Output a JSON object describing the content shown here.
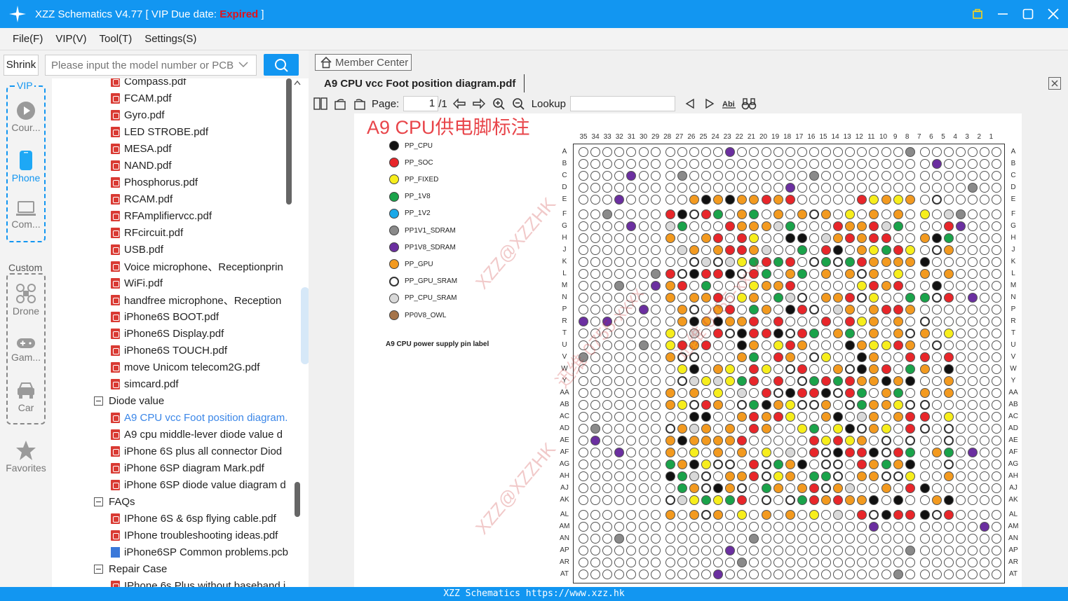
{
  "window": {
    "title_prefix": "XZZ Schematics V4.77 [ VIP Due date: ",
    "title_status": "Expired",
    "title_suffix": " ]"
  },
  "menu": [
    "File(F)",
    "VIP(V)",
    "Tool(T)",
    "Settings(S)"
  ],
  "search": {
    "shrink_label": "Shrink",
    "placeholder": "Please input the model number or PCB"
  },
  "rail": {
    "vip_label": "VIP",
    "custom_label": "Custom",
    "items": [
      "Cour...",
      "Phone",
      "Com...",
      "Drone",
      "Gam...",
      "Car",
      "Favorites"
    ]
  },
  "tree": {
    "items": [
      {
        "type": "pdf",
        "label": "Compass.pdf"
      },
      {
        "type": "pdf",
        "label": "FCAM.pdf"
      },
      {
        "type": "pdf",
        "label": "Gyro.pdf"
      },
      {
        "type": "pdf",
        "label": "LED STROBE.pdf"
      },
      {
        "type": "pdf",
        "label": "MESA.pdf"
      },
      {
        "type": "pdf",
        "label": "NAND.pdf"
      },
      {
        "type": "pdf",
        "label": "Phosphorus.pdf"
      },
      {
        "type": "pdf",
        "label": "RCAM.pdf"
      },
      {
        "type": "pdf",
        "label": "RFAmplifiervcc.pdf"
      },
      {
        "type": "pdf",
        "label": "RFcircuit.pdf"
      },
      {
        "type": "pdf",
        "label": "USB.pdf"
      },
      {
        "type": "pdf",
        "label": "Voice microphone、Receptionprin"
      },
      {
        "type": "pdf",
        "label": "WiFi.pdf"
      },
      {
        "type": "pdf",
        "label": "handfree microphone、Reception"
      },
      {
        "type": "pdf",
        "label": "iPhone6S BOOT.pdf"
      },
      {
        "type": "pdf",
        "label": "iPhone6S Display.pdf"
      },
      {
        "type": "pdf",
        "label": "iPhone6S TOUCH.pdf"
      },
      {
        "type": "pdf",
        "label": "move Unicom telecom2G.pdf"
      },
      {
        "type": "pdf",
        "label": "simcard.pdf"
      },
      {
        "type": "folder",
        "label": "Diode value"
      },
      {
        "type": "pdf",
        "label": "A9 CPU vcc Foot position diagram.",
        "selected": true
      },
      {
        "type": "pdf",
        "label": "A9 cpu middle-lever diode value d"
      },
      {
        "type": "pdf",
        "label": "iPhone 6S plus all connector Diod"
      },
      {
        "type": "pdf",
        "label": "iPhone 6SP diagram Mark.pdf"
      },
      {
        "type": "pdf",
        "label": "iPhone 6SP diode value diagram d"
      },
      {
        "type": "folder",
        "label": "FAQs"
      },
      {
        "type": "pdf",
        "label": "IPhone 6S & 6sp flying cable.pdf"
      },
      {
        "type": "pdf",
        "label": "IPhone troubleshooting ideas.pdf"
      },
      {
        "type": "pcb",
        "label": "iPhone6SP Common problems.pcb"
      },
      {
        "type": "folder",
        "label": "Repair Case"
      },
      {
        "type": "pdf",
        "label": "IPhone 6s Plus without baseband i"
      }
    ]
  },
  "viewer": {
    "member_center": "Member Center",
    "doc_tab": "A9 CPU vcc Foot position diagram.pdf",
    "page_label": "Page:",
    "page_value": "1",
    "page_total": "/1",
    "lookup_label": "Lookup"
  },
  "document": {
    "title": "A9 CPU供电脚标注",
    "caption": "A9 CPU power supply pin label",
    "legend": [
      {
        "label": "PP_CPU",
        "color": "#111111"
      },
      {
        "label": "PP_SOC",
        "color": "#e8262a"
      },
      {
        "label": "PP_FIXED",
        "color": "#f7ee1c"
      },
      {
        "label": "PP_1V8",
        "color": "#1aa34a"
      },
      {
        "label": "PP_1V2",
        "color": "#1ba8e8"
      },
      {
        "label": "PP1V1_SDRAM",
        "color": "#8a8a8a"
      },
      {
        "label": "PP1V8_SDRAM",
        "color": "#6b2fa0"
      },
      {
        "label": "PP_GPU",
        "color": "#f39a1f"
      },
      {
        "label": "PP_GPU_SRAM",
        "color": "#ffffff"
      },
      {
        "label": "PP_CPU_SRAM",
        "color": "#d9d9d9"
      },
      {
        "label": "PP0V8_OWL",
        "color": "#a5744a"
      }
    ],
    "columns": [
      "35",
      "34",
      "33",
      "32",
      "31",
      "30",
      "29",
      "28",
      "27",
      "26",
      "25",
      "24",
      "23",
      "22",
      "21",
      "20",
      "19",
      "18",
      "17",
      "16",
      "15",
      "14",
      "13",
      "12",
      "11",
      "10",
      "9",
      "8",
      "7",
      "6",
      "5",
      "4",
      "3",
      "2",
      "1"
    ],
    "rows": [
      "A",
      "B",
      "C",
      "D",
      "E",
      "F",
      "G",
      "H",
      "J",
      "K",
      "L",
      "M",
      "N",
      "P",
      "R",
      "T",
      "U",
      "V",
      "W",
      "Y",
      "AA",
      "AB",
      "AC",
      "AD",
      "AE",
      "AF",
      "AG",
      "AH",
      "AJ",
      "AK",
      "AL",
      "AM",
      "AN",
      "AP",
      "AR",
      "AT"
    ],
    "watermarks": [
      "XZZ@XZZHK",
      "迅维 0755-xxxx",
      "XZZ@XZZHK",
      "迅维 0755-xxxx"
    ]
  },
  "status": {
    "text": "XZZ Schematics https://www.xzz.hk"
  }
}
